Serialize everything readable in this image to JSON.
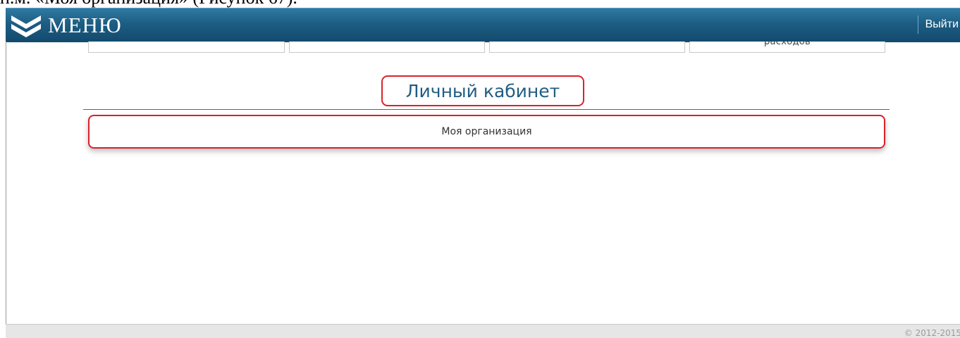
{
  "document": {
    "caption": "п.м. «Моя организация» (Рисунок 67)."
  },
  "header": {
    "menu_icon": "double-chevron-down-icon",
    "menu_label": "МЕНЮ",
    "logout_label": "Выйти"
  },
  "tiles": [
    "",
    "",
    "",
    "расходов"
  ],
  "section": {
    "title": "Личный кабинет",
    "items": [
      {
        "label": "Моя организация"
      }
    ]
  },
  "footer": {
    "copyright": "© 2012-2015"
  },
  "colors": {
    "header_bg": "#1d5d83",
    "title_color": "#1f5d82",
    "highlight_red": "#d8232a",
    "footer_bg": "#e6e6e6"
  }
}
